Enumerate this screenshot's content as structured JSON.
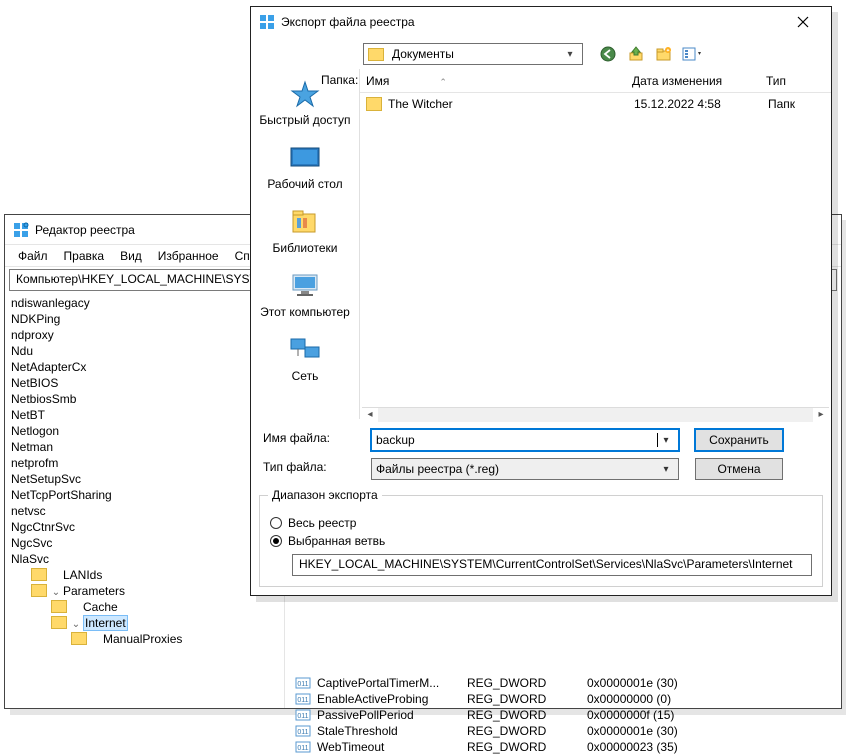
{
  "regedit": {
    "title": "Редактор реестра",
    "menu": [
      "Файл",
      "Правка",
      "Вид",
      "Избранное",
      "Спр"
    ],
    "address": "Компьютер\\HKEY_LOCAL_MACHINE\\SYST",
    "tree": [
      {
        "label": "ndiswanlegacy",
        "indent": 0
      },
      {
        "label": "NDKPing",
        "indent": 0
      },
      {
        "label": "ndproxy",
        "indent": 0
      },
      {
        "label": "Ndu",
        "indent": 0
      },
      {
        "label": "NetAdapterCx",
        "indent": 0
      },
      {
        "label": "NetBIOS",
        "indent": 0
      },
      {
        "label": "NetbiosSmb",
        "indent": 0
      },
      {
        "label": "NetBT",
        "indent": 0
      },
      {
        "label": "Netlogon",
        "indent": 0
      },
      {
        "label": "Netman",
        "indent": 0
      },
      {
        "label": "netprofm",
        "indent": 0
      },
      {
        "label": "NetSetupSvc",
        "indent": 0
      },
      {
        "label": "NetTcpPortSharing",
        "indent": 0
      },
      {
        "label": "netvsc",
        "indent": 0
      },
      {
        "label": "NgcCtnrSvc",
        "indent": 0
      },
      {
        "label": "NgcSvc",
        "indent": 0
      },
      {
        "label": "NlaSvc",
        "indent": 0
      },
      {
        "label": "LANIds",
        "indent": 1,
        "folder": true
      },
      {
        "label": "Parameters",
        "indent": 1,
        "folder": true,
        "exp": "v"
      },
      {
        "label": "Cache",
        "indent": 2,
        "folder": true
      },
      {
        "label": "Internet",
        "indent": 2,
        "folder": true,
        "sel": true,
        "exp": "v"
      },
      {
        "label": "ManualProxies",
        "indent": 3,
        "folder": true
      }
    ],
    "values": [
      {
        "name": "CaptivePortalTimerM...",
        "type": "REG_DWORD",
        "data": "0x0000001e (30)"
      },
      {
        "name": "EnableActiveProbing",
        "type": "REG_DWORD",
        "data": "0x00000000 (0)"
      },
      {
        "name": "PassivePollPeriod",
        "type": "REG_DWORD",
        "data": "0x0000000f (15)"
      },
      {
        "name": "StaleThreshold",
        "type": "REG_DWORD",
        "data": "0x0000001e (30)"
      },
      {
        "name": "WebTimeout",
        "type": "REG_DWORD",
        "data": "0x00000023 (35)"
      }
    ]
  },
  "export": {
    "title": "Экспорт файла реестра",
    "folder_label": "Папка:",
    "current_folder": "Документы",
    "sidebar": [
      {
        "name": "Быстрый доступ",
        "icon": "star"
      },
      {
        "name": "Рабочий стол",
        "icon": "desktop"
      },
      {
        "name": "Библиотеки",
        "icon": "libraries"
      },
      {
        "name": "Этот компьютер",
        "icon": "pc"
      },
      {
        "name": "Сеть",
        "icon": "network"
      }
    ],
    "columns": {
      "name": "Имя",
      "date": "Дата изменения",
      "type": "Тип"
    },
    "files": [
      {
        "name": "The Witcher",
        "date": "15.12.2022 4:58",
        "type": "Папк"
      }
    ],
    "filename_label": "Имя файла:",
    "filetype_label": "Тип файла:",
    "filename_value": "backup",
    "filetype_value": "Файлы реестра (*.reg)",
    "save_btn": "Сохранить",
    "cancel_btn": "Отмена",
    "range_legend": "Диапазон экспорта",
    "range_all": "Весь реестр",
    "range_branch": "Выбранная ветвь",
    "branch_path": "HKEY_LOCAL_MACHINE\\SYSTEM\\CurrentControlSet\\Services\\NlaSvc\\Parameters\\Internet"
  }
}
